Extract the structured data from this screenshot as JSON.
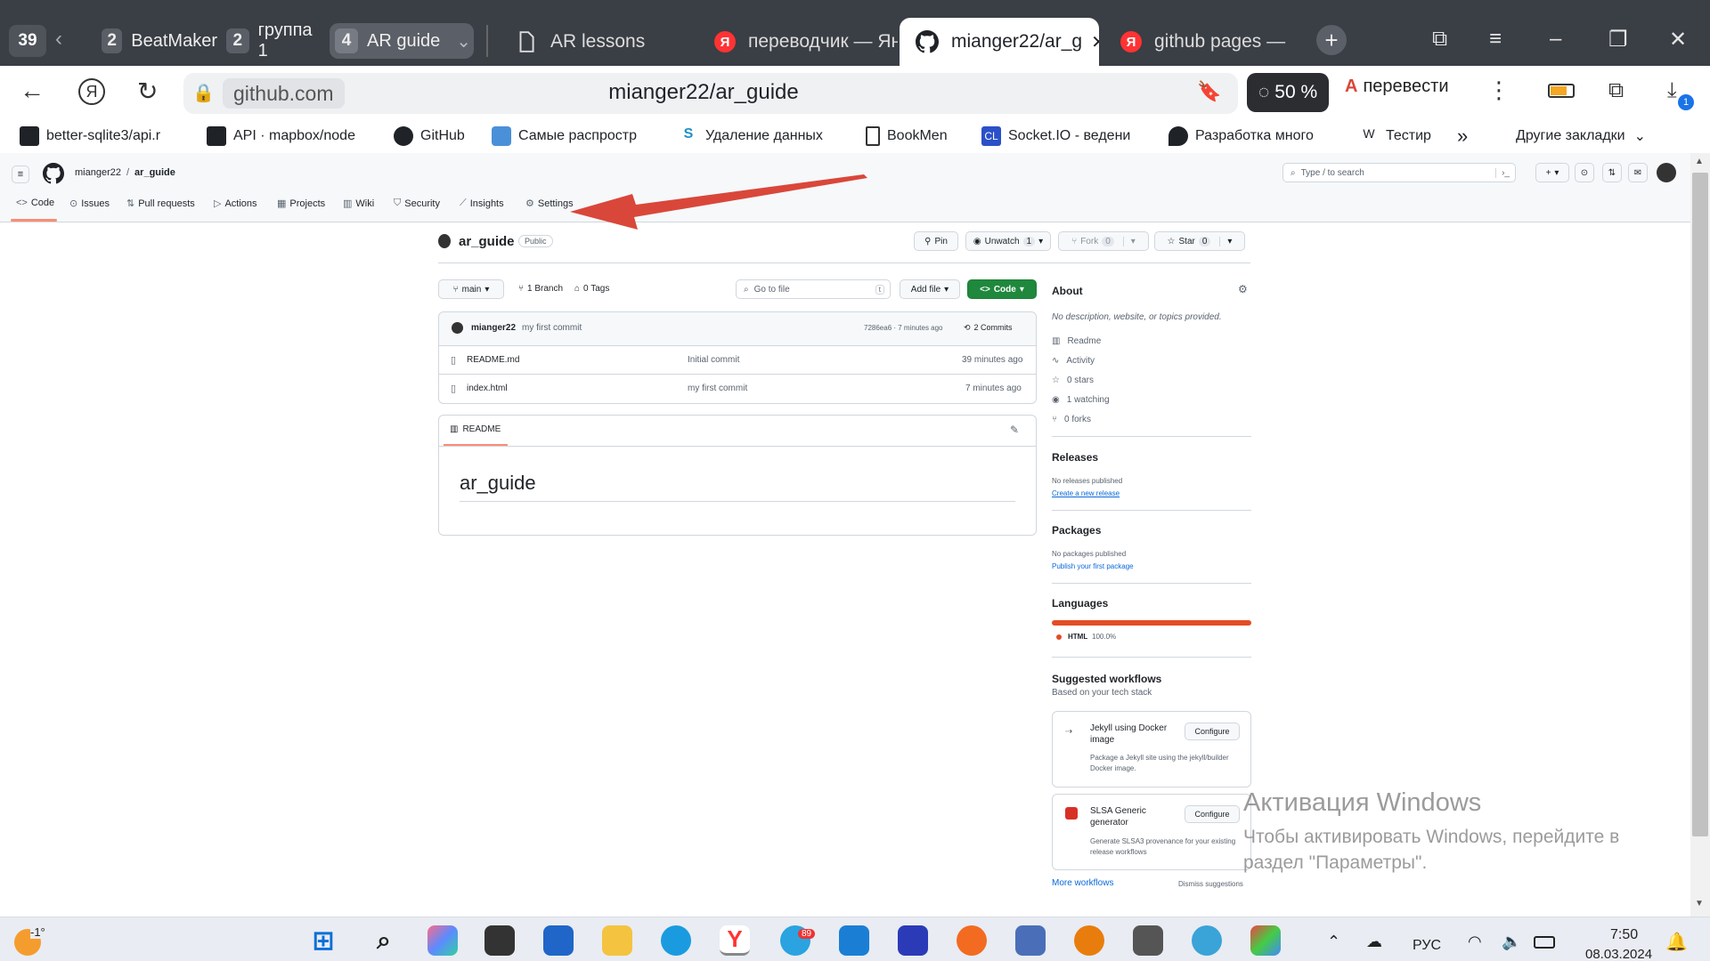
{
  "browser": {
    "tab_count": "39",
    "groups": [
      {
        "num": "2",
        "label": "BeatMaker"
      },
      {
        "num": "2",
        "label": "группа 1"
      },
      {
        "num": "4",
        "label": "AR guide"
      }
    ],
    "tabs": [
      {
        "label": "AR lessons",
        "icon": "page-icon"
      },
      {
        "label": "переводчик — Ян",
        "icon": "yandex-icon"
      },
      {
        "label": "mianger22/ar_g",
        "icon": "github-icon",
        "active": true
      },
      {
        "label": "github pages — Я",
        "icon": "yandex-icon"
      }
    ],
    "address": {
      "host": "github.com",
      "path": "mianger22/ar_guide"
    },
    "zoom": "50 %",
    "translate_label": "перевести",
    "downloads_badge": "1",
    "bookmarks": [
      "better-sqlite3/api.r",
      "API · mapbox/node",
      "GitHub",
      "Самые распростр",
      "Удаление данных",
      "BookMen",
      "Socket.IO - ведени",
      "Разработка много",
      "Тестир"
    ],
    "bookmarks_more": "»",
    "other_bookmarks": "Другие закладки"
  },
  "github": {
    "breadcrumb": {
      "owner": "mianger22",
      "sep": "/",
      "repo": "ar_guide"
    },
    "search_placeholder": "Type / to search",
    "nav": [
      "Code",
      "Issues",
      "Pull requests",
      "Actions",
      "Projects",
      "Wiki",
      "Security",
      "Insights",
      "Settings"
    ],
    "repo": {
      "name": "ar_guide",
      "visibility": "Public",
      "pin": "Pin",
      "unwatch": "Unwatch",
      "unwatch_count": "1",
      "fork": "Fork",
      "fork_count": "0",
      "star": "Star",
      "star_count": "0"
    },
    "toolbar": {
      "branch": "main",
      "branches": "1 Branch",
      "tags": "0 Tags",
      "goto_placeholder": "Go to file",
      "goto_key": "t",
      "add_file": "Add file",
      "code": "Code"
    },
    "commit": {
      "author": "mianger22",
      "message": "my first commit",
      "hash_time": "7286ea6 · 7 minutes ago",
      "commits": "2 Commits"
    },
    "files": [
      {
        "name": "README.md",
        "msg": "Initial commit",
        "time": "39 minutes ago"
      },
      {
        "name": "index.html",
        "msg": "my first commit",
        "time": "7 minutes ago"
      }
    ],
    "readme": {
      "tab": "README",
      "heading": "ar_guide"
    },
    "about": {
      "title": "About",
      "desc": "No description, website, or topics provided.",
      "items": [
        "Readme",
        "Activity",
        "0 stars",
        "1 watching",
        "0 forks"
      ]
    },
    "releases": {
      "title": "Releases",
      "none": "No releases published",
      "link": "Create a new release"
    },
    "packages": {
      "title": "Packages",
      "none": "No packages published",
      "link": "Publish your first package"
    },
    "languages": {
      "title": "Languages",
      "lang": "HTML",
      "pct": "100.0%",
      "color": "#e34c26"
    },
    "workflows": {
      "title": "Suggested workflows",
      "subtitle": "Based on your tech stack",
      "items": [
        {
          "name": "Jekyll using Docker image",
          "desc": "Package a Jekyll site using the jekyll/builder Docker image.",
          "btn": "Configure"
        },
        {
          "name": "SLSA Generic generator",
          "desc": "Generate SLSA3 provenance for your existing release workflows",
          "btn": "Configure"
        }
      ],
      "more": "More workflows",
      "dismiss": "Dismiss suggestions"
    }
  },
  "watermark": {
    "line1": "Активация Windows",
    "line2": "Чтобы активировать Windows, перейдите в раздел \"Параметры\"."
  },
  "taskbar": {
    "weather": "-1°",
    "telegram_badge": "89",
    "lang": "РУС",
    "time": "7:50",
    "date": "08.03.2024"
  },
  "colors": {
    "accent": "#1f883d",
    "arrow": "#d9473a",
    "nav_underline": "#fd8c73"
  }
}
